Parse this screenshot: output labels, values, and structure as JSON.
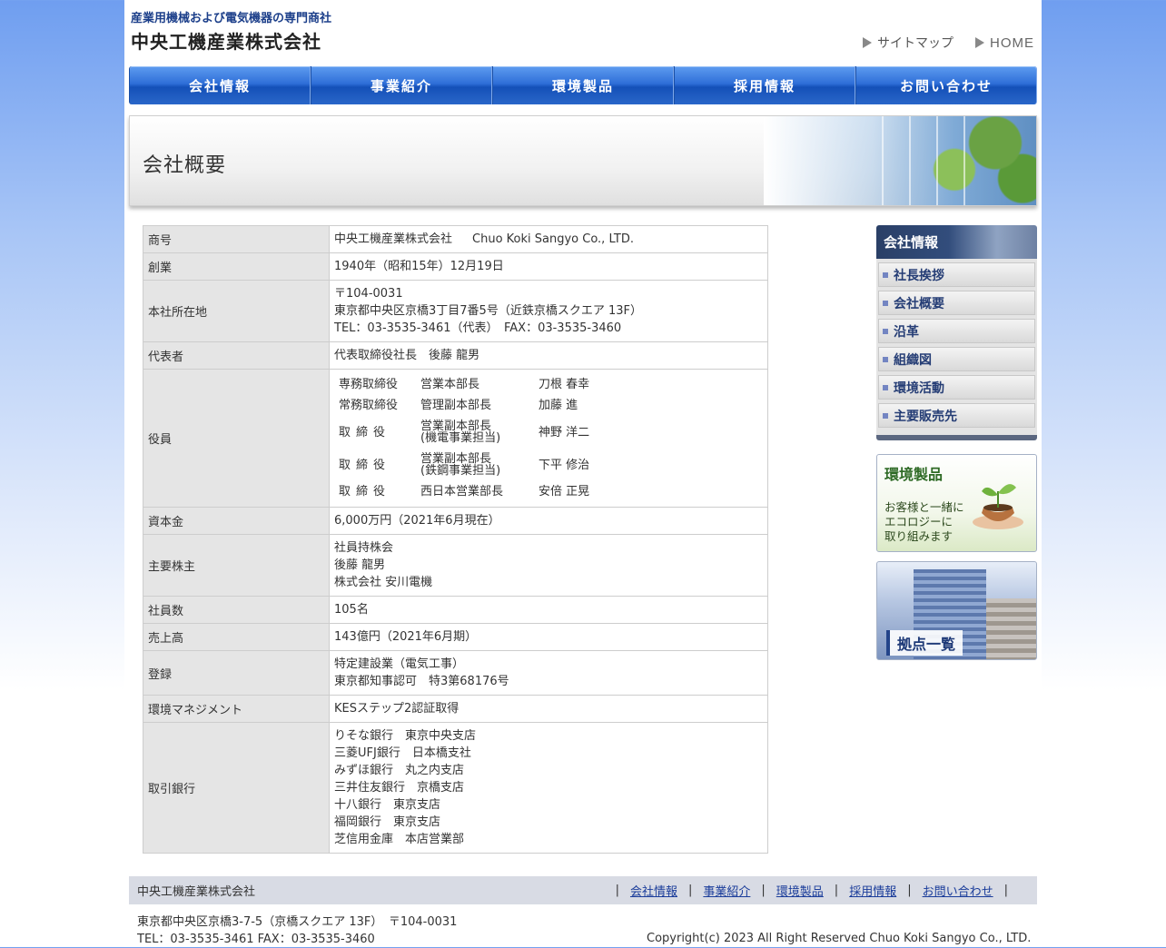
{
  "header": {
    "tagline": "産業用機械および電気機器の専門商社",
    "company_name": "中央工機産業株式会社",
    "links": [
      {
        "label": "サイトマップ"
      },
      {
        "label": "HOME"
      }
    ]
  },
  "nav": [
    "会社情報",
    "事業紹介",
    "環境製品",
    "採用情報",
    "お問い合わせ"
  ],
  "banner": {
    "title": "会社概要"
  },
  "profile": {
    "trade_name": {
      "label": "商号",
      "value_ja": "中央工機産業株式会社",
      "value_en": "Chuo Koki Sangyo Co., LTD."
    },
    "founded": {
      "label": "創業",
      "value": "1940年（昭和15年）12月19日"
    },
    "hq": {
      "label": "本社所在地",
      "postal": "〒104-0031",
      "address": "東京都中央区京橋3丁目7番5号（近鉄京橋スクエア 13F）",
      "phone": "TEL：03-3535-3461（代表）　FAX：03-3535-3460"
    },
    "representative": {
      "label": "代表者",
      "value": "代表取締役社長　後藤 龍男"
    },
    "officers": {
      "label": "役員",
      "rows": [
        {
          "title": "専務取締役",
          "dept": "営業本部長",
          "dept2": "",
          "name": "刀根 春幸"
        },
        {
          "title": "常務取締役",
          "dept": "管理副本部長",
          "dept2": "",
          "name": "加藤 進"
        },
        {
          "title": "取締役",
          "dept": "営業副本部長",
          "dept2": "(機電事業担当)",
          "name": "神野 洋二"
        },
        {
          "title": "取締役",
          "dept": "営業副本部長",
          "dept2": "(鉄鋼事業担当)",
          "name": "下平 修治"
        },
        {
          "title": "取締役",
          "dept": "西日本営業部長",
          "dept2": "",
          "name": "安倍 正晃"
        }
      ]
    },
    "capital": {
      "label": "資本金",
      "value": "6,000万円（2021年6月現在）"
    },
    "shareholders": {
      "label": "主要株主",
      "values": [
        "社員持株会",
        "後藤 龍男",
        "株式会社 安川電機"
      ]
    },
    "employees": {
      "label": "社員数",
      "value": "105名"
    },
    "sales": {
      "label": "売上高",
      "value": "143億円（2021年6月期）"
    },
    "registration": {
      "label": "登録",
      "values": [
        "特定建設業（電気工事）",
        "東京都知事認可　特3第68176号"
      ]
    },
    "env_mgmt": {
      "label": "環境マネジメント",
      "value": "KESステップ2認証取得"
    },
    "banks": {
      "label": "取引銀行",
      "values": [
        "りそな銀行　東京中央支店",
        "三菱UFJ銀行　日本橋支社",
        "みずほ銀行　丸之内支店",
        "三井住友銀行　京橋支店",
        "十八銀行　東京支店",
        "福岡銀行　東京支店",
        "芝信用金庫　本店営業部"
      ]
    }
  },
  "sidebar": {
    "heading": "会社情報",
    "items": [
      "社長挨拶",
      "会社概要",
      "沿革",
      "組織図",
      "環境活動",
      "主要販売先"
    ],
    "promo_eco": {
      "title": "環境製品",
      "lines": [
        "お客様と一緒に",
        "エコロジーに",
        "取り組みます"
      ]
    },
    "promo_bases": {
      "label": "拠点一覧"
    }
  },
  "footer": {
    "company": "中央工機産業株式会社",
    "links": [
      "会社情報",
      "事業紹介",
      "環境製品",
      "採用情報",
      "お問い合わせ"
    ],
    "address": "東京都中央区京橋3-7-5（京橋スクエア 13F）　〒104-0031",
    "phone": "TEL：03-3535-3461 FAX：03-3535-3460",
    "copyright": "Copyright(c) 2023 All Right Reserved Chuo Koki Sangyo Co., LTD."
  }
}
